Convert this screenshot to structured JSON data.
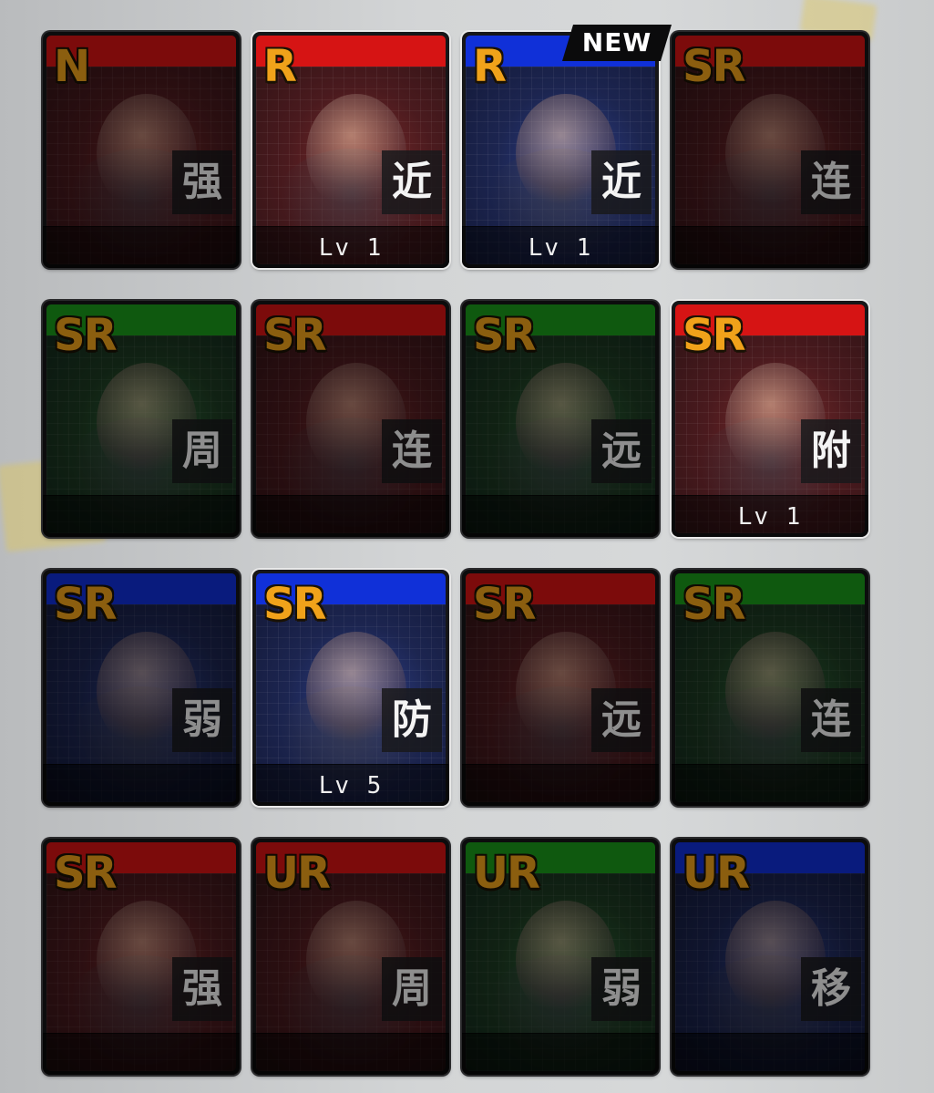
{
  "colors": {
    "band_red": "#d61414",
    "band_blue": "#1030d8",
    "band_green": "#1b9a1b",
    "rarity_text": "#f0a21a",
    "badge_bg": "#0b0b0c"
  },
  "new_badge": "NEW",
  "cards": [
    {
      "rarity": "N",
      "type": "强",
      "level": "",
      "band": "red",
      "state": "locked",
      "icon": "character-boots-icon"
    },
    {
      "rarity": "R",
      "type": "近",
      "level": "Lv 1",
      "band": "red",
      "state": "owned",
      "icon": "pixel-bug-icon"
    },
    {
      "rarity": "R",
      "type": "近",
      "level": "Lv 1",
      "band": "blue",
      "state": "owned",
      "icon": "purple-fist-icon",
      "is_new": true
    },
    {
      "rarity": "SR",
      "type": "连",
      "level": "",
      "band": "red",
      "state": "locked",
      "icon": "gunner-icon"
    },
    {
      "rarity": "SR",
      "type": "周",
      "level": "",
      "band": "green",
      "state": "locked",
      "icon": "electric-spirit-icon"
    },
    {
      "rarity": "SR",
      "type": "连",
      "level": "",
      "band": "red",
      "state": "locked",
      "icon": "knight-icon"
    },
    {
      "rarity": "SR",
      "type": "远",
      "level": "",
      "band": "green",
      "state": "locked",
      "icon": "rifleman-icon"
    },
    {
      "rarity": "SR",
      "type": "附",
      "level": "Lv 1",
      "band": "red",
      "state": "owned",
      "icon": "flame-beast-icon"
    },
    {
      "rarity": "SR",
      "type": "弱",
      "level": "",
      "band": "blue",
      "state": "locked",
      "icon": "armored-car-icon"
    },
    {
      "rarity": "SR",
      "type": "防",
      "level": "Lv 5",
      "band": "blue",
      "state": "owned",
      "icon": "golden-golem-icon"
    },
    {
      "rarity": "SR",
      "type": "远",
      "level": "",
      "band": "red",
      "state": "locked",
      "icon": "agent-icon"
    },
    {
      "rarity": "SR",
      "type": "连",
      "level": "",
      "band": "green",
      "state": "locked",
      "icon": "rabbit-bear-icon"
    },
    {
      "rarity": "SR",
      "type": "强",
      "level": "",
      "band": "red",
      "state": "locked",
      "icon": "comic-girl-icon"
    },
    {
      "rarity": "UR",
      "type": "周",
      "level": "",
      "band": "red",
      "state": "locked",
      "icon": "muscle-hero-icon"
    },
    {
      "rarity": "UR",
      "type": "弱",
      "level": "",
      "band": "green",
      "state": "locked",
      "icon": "light-burst-icon"
    },
    {
      "rarity": "UR",
      "type": "移",
      "level": "",
      "band": "blue",
      "state": "locked",
      "icon": "teleporter-icon"
    }
  ]
}
